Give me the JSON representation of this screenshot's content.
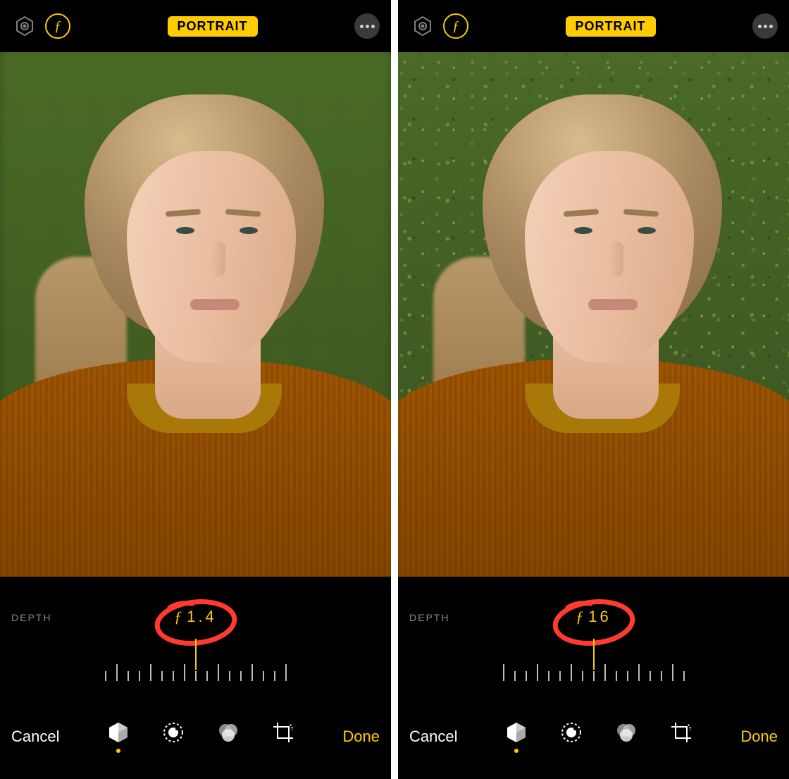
{
  "left": {
    "topbar": {
      "mode_label": "PORTRAIT",
      "f_glyph": "ƒ"
    },
    "depth": {
      "label": "DEPTH",
      "f_glyph": "ƒ",
      "value": "1.4"
    },
    "bottombar": {
      "cancel": "Cancel",
      "done": "Done",
      "icons": {
        "lighting": "lighting",
        "adjust": "adjust",
        "filters": "filters",
        "crop": "crop"
      }
    },
    "annotation": {
      "color": "#ff3b30"
    }
  },
  "right": {
    "topbar": {
      "mode_label": "PORTRAIT",
      "f_glyph": "ƒ"
    },
    "depth": {
      "label": "DEPTH",
      "f_glyph": "ƒ",
      "value": "16"
    },
    "bottombar": {
      "cancel": "Cancel",
      "done": "Done",
      "icons": {
        "lighting": "lighting",
        "adjust": "adjust",
        "filters": "filters",
        "crop": "crop"
      }
    },
    "annotation": {
      "color": "#ff3b30"
    }
  }
}
